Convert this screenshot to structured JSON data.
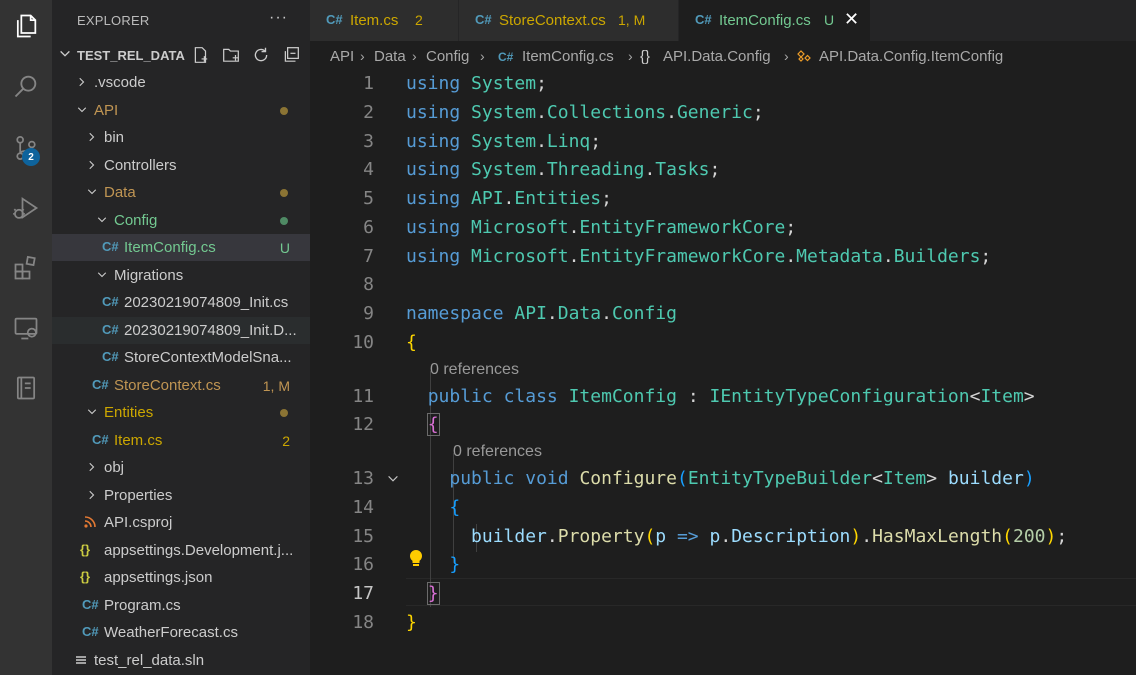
{
  "activity_bar": {
    "icons": [
      "explorer-icon",
      "search-icon",
      "source-control-icon",
      "run-debug-icon",
      "extensions-icon",
      "remote-explorer-icon",
      "notebook-icon"
    ],
    "source_control_badge": "2"
  },
  "sidebar": {
    "title": "EXPLORER",
    "more": "···",
    "workspace": "TEST_REL_DATA",
    "items": [
      {
        "label": ".vscode",
        "status": ""
      },
      {
        "label": "API",
        "status": ""
      },
      {
        "label": "bin",
        "status": ""
      },
      {
        "label": "Controllers",
        "status": ""
      },
      {
        "label": "Data",
        "status": ""
      },
      {
        "label": "Config",
        "status": ""
      },
      {
        "label": "ItemConfig.cs",
        "status": "U"
      },
      {
        "label": "Migrations",
        "status": ""
      },
      {
        "label": "20230219074809_Init.cs",
        "status": ""
      },
      {
        "label": "20230219074809_Init.D...",
        "status": ""
      },
      {
        "label": "StoreContextModelSna...",
        "status": ""
      },
      {
        "label": "StoreContext.cs",
        "status": "1, M"
      },
      {
        "label": "Entities",
        "status": ""
      },
      {
        "label": "Item.cs",
        "status": "2"
      },
      {
        "label": "obj",
        "status": ""
      },
      {
        "label": "Properties",
        "status": ""
      },
      {
        "label": "API.csproj",
        "status": ""
      },
      {
        "label": "appsettings.Development.j...",
        "status": ""
      },
      {
        "label": "appsettings.json",
        "status": ""
      },
      {
        "label": "Program.cs",
        "status": ""
      },
      {
        "label": "WeatherForecast.cs",
        "status": ""
      },
      {
        "label": "test_rel_data.sln",
        "status": ""
      }
    ]
  },
  "tabs": [
    {
      "label": "Item.cs",
      "status": "2"
    },
    {
      "label": "StoreContext.cs",
      "status": "1, M"
    },
    {
      "label": "ItemConfig.cs",
      "status": "U"
    }
  ],
  "breadcrumb": [
    "API",
    "Data",
    "Config",
    "ItemConfig.cs",
    "API.Data.Config",
    "API.Data.Config.ItemConfig"
  ],
  "editor": {
    "line_numbers": [
      "1",
      "2",
      "3",
      "4",
      "5",
      "6",
      "7",
      "8",
      "9",
      "10",
      "11",
      "12",
      "13",
      "14",
      "15",
      "16",
      "17",
      "18"
    ],
    "codelens": [
      "0 references",
      "0 references"
    ],
    "current_line": "17"
  },
  "colors": {
    "modified": "#c09553",
    "untracked": "#73c991",
    "error": "#cca700"
  }
}
